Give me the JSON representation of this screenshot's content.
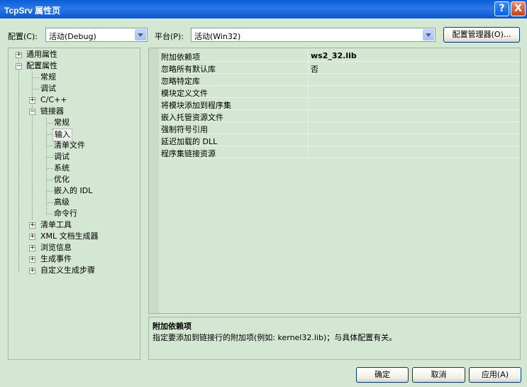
{
  "window": {
    "title": "TcpSrv 属性页",
    "help_glyph": "?",
    "close_glyph": "X"
  },
  "config_row": {
    "config_label": "配置(C):",
    "config_value": "活动(Debug)",
    "platform_label": "平台(P):",
    "platform_value": "活动(Win32)",
    "manager_button": "配置管理器(O)..."
  },
  "tree": {
    "items": [
      {
        "label": "通用属性",
        "expander": "+"
      },
      {
        "label": "配置属性",
        "expander": "−"
      },
      {
        "label": "常规"
      },
      {
        "label": "调试"
      },
      {
        "label": "C/C++",
        "expander": "+"
      },
      {
        "label": "链接器",
        "expander": "−"
      },
      {
        "label": "常规"
      },
      {
        "label": "输入"
      },
      {
        "label": "清单文件"
      },
      {
        "label": "调试"
      },
      {
        "label": "系统"
      },
      {
        "label": "优化"
      },
      {
        "label": "嵌入的 IDL"
      },
      {
        "label": "高级"
      },
      {
        "label": "命令行"
      },
      {
        "label": "清单工具",
        "expander": "+"
      },
      {
        "label": "XML 文档生成器",
        "expander": "+"
      },
      {
        "label": "浏览信息",
        "expander": "+"
      },
      {
        "label": "生成事件",
        "expander": "+"
      },
      {
        "label": "自定义生成步骤",
        "expander": "+"
      }
    ]
  },
  "properties": {
    "rows": [
      {
        "name": "附加依赖项",
        "value": "ws2_32.lib"
      },
      {
        "name": "忽略所有默认库",
        "value": "否"
      },
      {
        "name": "忽略特定库",
        "value": ""
      },
      {
        "name": "模块定义文件",
        "value": ""
      },
      {
        "name": "将模块添加到程序集",
        "value": ""
      },
      {
        "name": "嵌入托管资源文件",
        "value": ""
      },
      {
        "name": "强制符号引用",
        "value": ""
      },
      {
        "name": "延迟加载的 DLL",
        "value": ""
      },
      {
        "name": "程序集链接资源",
        "value": ""
      }
    ]
  },
  "description": {
    "title": "附加依赖项",
    "text": "指定要添加到链接行的附加项(例如: kernel32.lib)；与具体配置有关。"
  },
  "buttons": {
    "ok": "确定",
    "cancel": "取消",
    "apply": "应用(A)"
  }
}
